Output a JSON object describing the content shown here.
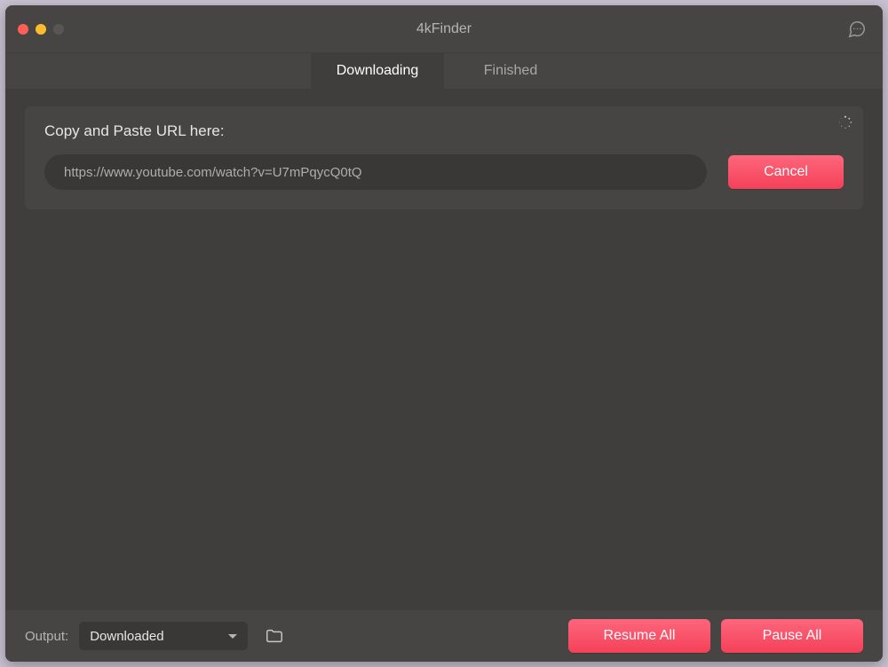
{
  "titlebar": {
    "title": "4kFinder"
  },
  "tabs": {
    "downloading": "Downloading",
    "finished": "Finished"
  },
  "urlPanel": {
    "label": "Copy and Paste URL here:",
    "inputValue": "https://www.youtube.com/watch?v=U7mPqycQ0tQ",
    "cancel": "Cancel"
  },
  "bottom": {
    "outputLabel": "Output:",
    "outputSelected": "Downloaded",
    "resumeAll": "Resume All",
    "pauseAll": "Pause All"
  },
  "colors": {
    "accentTop": "#fd677c",
    "accentBottom": "#f44159"
  }
}
